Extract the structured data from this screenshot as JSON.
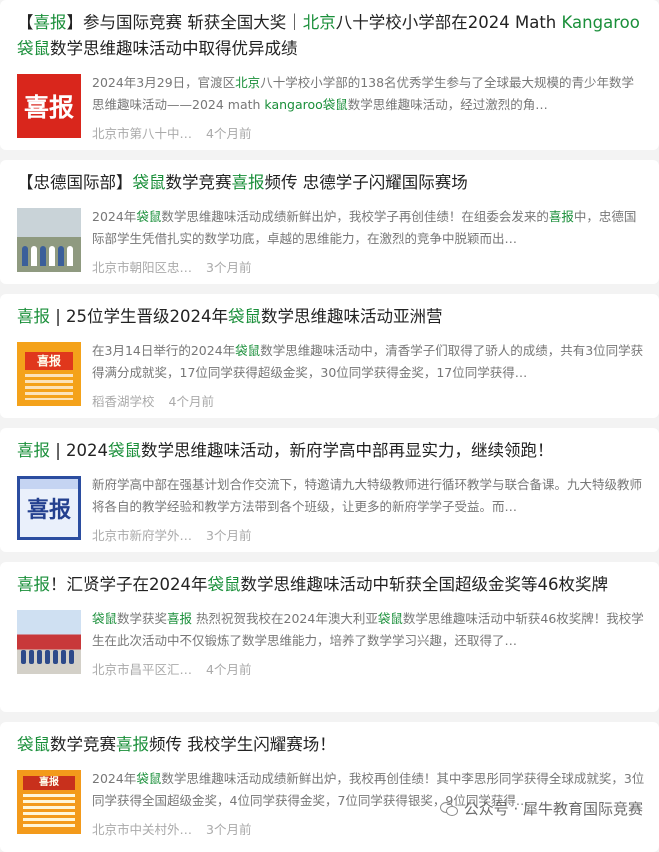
{
  "articles": [
    {
      "title": [
        {
          "t": "【",
          "h": false
        },
        {
          "t": "喜报",
          "h": true
        },
        {
          "t": "】参与国际竞赛 斩获全国大奖｜",
          "h": false
        },
        {
          "t": "北京",
          "h": true
        },
        {
          "t": "八十学校小学部在2024 Math ",
          "h": false
        },
        {
          "t": "Kangaroo",
          "h": true
        },
        {
          "t": "袋鼠",
          "h": true
        },
        {
          "t": "数学思维趣味活动中取得优异成绩",
          "h": false
        }
      ],
      "snippet": [
        {
          "t": "2024年3月29日，官渡区",
          "h": false
        },
        {
          "t": "北京",
          "h": true
        },
        {
          "t": "八十学校小学部的138名优秀学生参与了全球最大规模的青少年数学思维趣味活动——2024 math ",
          "h": false
        },
        {
          "t": "kangaroo",
          "h": true
        },
        {
          "t": "袋鼠",
          "h": true
        },
        {
          "t": "数学思维趣味活动，经过激烈的角…",
          "h": false
        }
      ],
      "source": "北京市第八十中…",
      "time": "4个月前",
      "thumb_text": "喜报",
      "thumb_icon": "red-xibao-poster-thumbnail"
    },
    {
      "title": [
        {
          "t": "【忠德国际部】",
          "h": false
        },
        {
          "t": "袋鼠",
          "h": true
        },
        {
          "t": "数学竞赛",
          "h": false
        },
        {
          "t": "喜报",
          "h": true
        },
        {
          "t": "频传 忠德学子闪耀国际赛场",
          "h": false
        }
      ],
      "snippet": [
        {
          "t": "2024年",
          "h": false
        },
        {
          "t": "袋鼠",
          "h": true
        },
        {
          "t": "数学思维趣味活动成绩新鲜出炉，我校学子再创佳绩！在组委会发来的",
          "h": false
        },
        {
          "t": "喜报",
          "h": true
        },
        {
          "t": "中，忠德国际部学生凭借扎实的数学功底，卓越的思维能力，在激烈的竞争中脱颖而出…",
          "h": false
        }
      ],
      "source": "北京市朝阳区忠…",
      "time": "3个月前",
      "thumb_text": "",
      "thumb_icon": "student-group-photo-thumbnail"
    },
    {
      "title": [
        {
          "t": "喜报",
          "h": true
        },
        {
          "t": " | 25位学生晋级2024年",
          "h": false
        },
        {
          "t": "袋鼠",
          "h": true
        },
        {
          "t": "数学思维趣味活动亚洲营",
          "h": false
        }
      ],
      "snippet": [
        {
          "t": "在3月14日举行的2024年",
          "h": false
        },
        {
          "t": "袋鼠",
          "h": true
        },
        {
          "t": "数学思维趣味活动中，清香学子们取得了骄人的成绩，共有3位同学获得满分成就奖，17位同学获得超级金奖，30位同学获得金奖，17位同学获得…",
          "h": false
        }
      ],
      "source": "稻香湖学校",
      "time": "4个月前",
      "thumb_text": "喜报",
      "thumb_icon": "orange-xibao-poster-thumbnail"
    },
    {
      "title": [
        {
          "t": "喜报",
          "h": true
        },
        {
          "t": " | 2024",
          "h": false
        },
        {
          "t": "袋鼠",
          "h": true
        },
        {
          "t": "数学思维趣味活动，新府学高中部再显实力，继续领跑！",
          "h": false
        }
      ],
      "snippet": [
        {
          "t": "新府学高中部在强基计划合作交流下，特邀请九大特级教师进行循环教学与联合备课。九大特级教师将各自的教学经验和教学方法带到各个班级，让更多的新府学学子受益。而…",
          "h": false
        }
      ],
      "source": "北京市新府学外…",
      "time": "3个月前",
      "thumb_text": "喜报",
      "thumb_icon": "blue-xibao-poster-thumbnail"
    },
    {
      "title": [
        {
          "t": "喜报",
          "h": true
        },
        {
          "t": "！汇贤学子在2024年",
          "h": false
        },
        {
          "t": "袋鼠",
          "h": true
        },
        {
          "t": "数学思维趣味活动中斩获全国超级金奖等46枚奖牌",
          "h": false
        }
      ],
      "snippet": [
        {
          "t": "袋鼠",
          "h": true
        },
        {
          "t": "数学获奖",
          "h": false
        },
        {
          "t": "喜报",
          "h": true
        },
        {
          "t": " 热烈祝贺我校在2024年澳大利亚",
          "h": false
        },
        {
          "t": "袋鼠",
          "h": true
        },
        {
          "t": "数学思维趣味活动中斩获46枚奖牌！我校学生在此次活动中不仅锻炼了数学思维能力，培养了数学学习兴趣，还取得了…",
          "h": false
        }
      ],
      "source": "北京市昌平区汇…",
      "time": "4个月前",
      "thumb_text": "",
      "thumb_icon": "award-ceremony-photo-thumbnail"
    },
    {
      "title": [
        {
          "t": "袋鼠",
          "h": true
        },
        {
          "t": "数学竞赛",
          "h": false
        },
        {
          "t": "喜报",
          "h": true
        },
        {
          "t": "频传 我校学生闪耀赛场！",
          "h": false
        }
      ],
      "snippet": [
        {
          "t": "2024年",
          "h": false
        },
        {
          "t": "袋鼠",
          "h": true
        },
        {
          "t": "数学思维趣味活动成绩新鲜出炉，我校再创佳绩！其中李思彤同学获得全球成就奖，3位同学获得全国超级金奖，4位同学获得金奖，7位同学获得银奖，9位同学获得…",
          "h": false
        }
      ],
      "source": "北京市中关村外…",
      "time": "3个月前",
      "thumb_text": "喜报",
      "thumb_icon": "orange-poster-thumbnail"
    }
  ],
  "watermark": "公众号 · 犀牛教育国际竞赛",
  "colors": {
    "highlight": "#1a8f3a",
    "background": "#f3f3f3"
  }
}
